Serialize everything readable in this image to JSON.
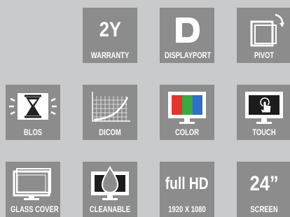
{
  "features": [
    {
      "id": "warranty",
      "big": "2Y",
      "label": "WARRANTY",
      "icon": "text-2y"
    },
    {
      "id": "displayport",
      "label": "DISPLAYPORT",
      "icon": "displayport-icon"
    },
    {
      "id": "pivot",
      "label": "PIVOT",
      "icon": "pivot-icon"
    },
    {
      "id": "blos",
      "label": "BLOS",
      "icon": "hourglass-monitor-icon"
    },
    {
      "id": "dicom",
      "label": "DICOM",
      "icon": "curve-grid-icon"
    },
    {
      "id": "color",
      "label": "COLOR",
      "icon": "rgb-monitor-icon"
    },
    {
      "id": "touch",
      "label": "TOUCH",
      "icon": "touch-monitor-icon"
    },
    {
      "id": "glass",
      "label": "GLASS COVER",
      "icon": "glass-monitor-icon"
    },
    {
      "id": "cleanable",
      "label": "CLEANABLE",
      "icon": "droplet-monitor-icon"
    },
    {
      "id": "fullhd",
      "big": "full HD",
      "label": "1920 X 1080",
      "icon": "text-full-hd"
    },
    {
      "id": "screen",
      "big": "24”",
      "label": "SCREEN",
      "icon": "text-24"
    }
  ],
  "colors": {
    "background": "#c8cacc",
    "tile": "#8c8c8c",
    "red": "#e0362c",
    "green": "#3aa843",
    "blue": "#2f6fc4"
  }
}
